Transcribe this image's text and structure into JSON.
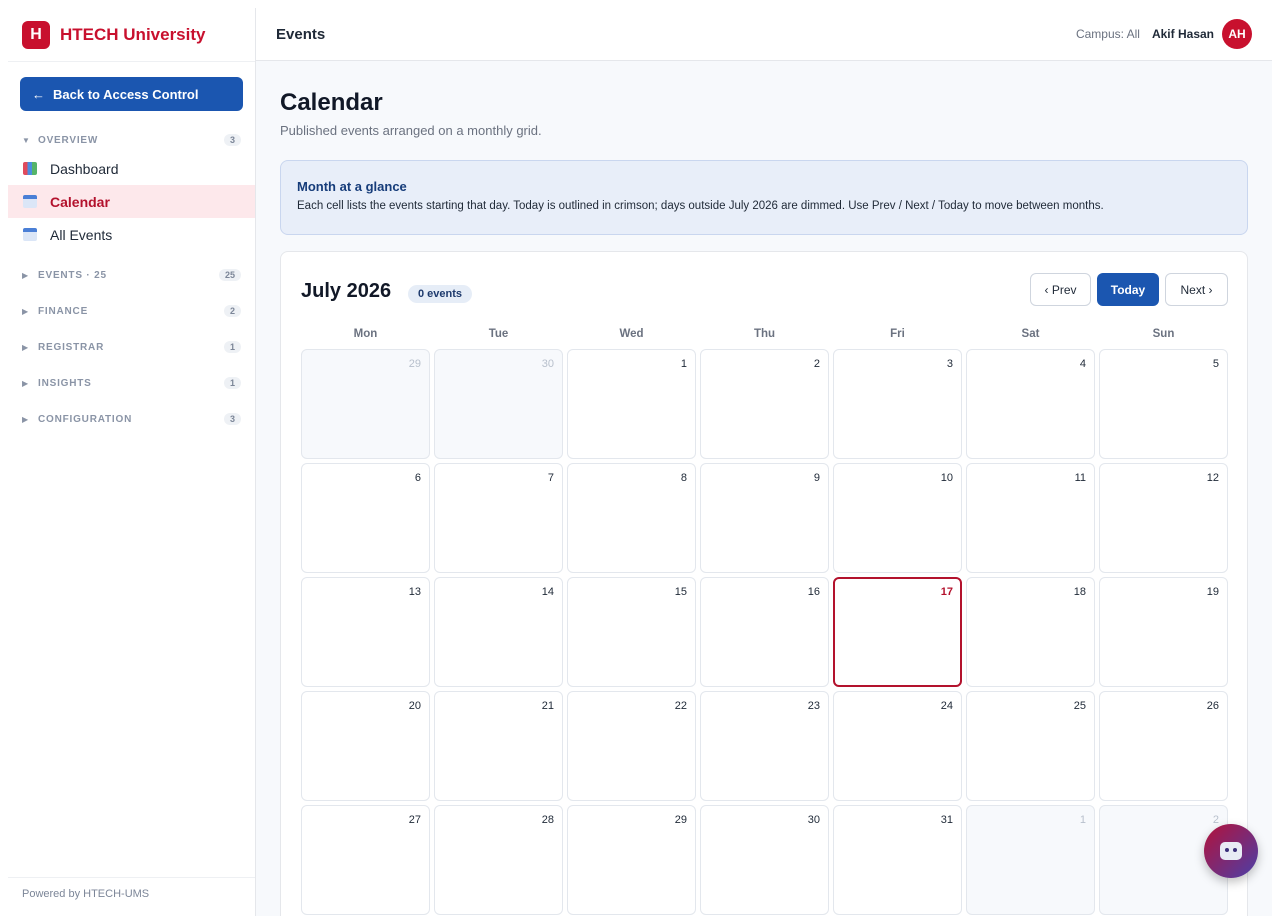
{
  "brand": {
    "logo": "H",
    "name": "HTECH University"
  },
  "sidebar": {
    "back_label": "Back to Access Control",
    "back_arrow": "←",
    "sections": [
      {
        "label": "OVERVIEW",
        "count": "3",
        "expanded": true,
        "items": [
          {
            "label": "Dashboard",
            "icon": "chart-icon",
            "active": false
          },
          {
            "label": "Calendar",
            "icon": "calendar-icon",
            "active": true
          },
          {
            "label": "All Events",
            "icon": "calendar-icon",
            "active": false
          }
        ]
      },
      {
        "label": "EVENTS · 25",
        "count": "25",
        "expanded": false
      },
      {
        "label": "FINANCE",
        "count": "2",
        "expanded": false
      },
      {
        "label": "REGISTRAR",
        "count": "1",
        "expanded": false
      },
      {
        "label": "INSIGHTS",
        "count": "1",
        "expanded": false
      },
      {
        "label": "CONFIGURATION",
        "count": "3",
        "expanded": false
      }
    ],
    "footer": "Powered by HTECH-UMS"
  },
  "topbar": {
    "title": "Events",
    "campus": "Campus: All",
    "user": "Akif Hasan",
    "avatar": "AH"
  },
  "page": {
    "title": "Calendar",
    "subtitle": "Published events arranged on a monthly grid.",
    "info_title": "Month at a glance",
    "info_text": "Each cell lists the events starting that day. Today is outlined in crimson; days outside July 2026 are dimmed. Use Prev / Next / Today to move between months."
  },
  "calendar": {
    "month": "July 2026",
    "events_badge": "0 events",
    "prev_label": "‹ Prev",
    "today_label": "Today",
    "next_label": "Next ›",
    "weekdays": [
      "Mon",
      "Tue",
      "Wed",
      "Thu",
      "Fri",
      "Sat",
      "Sun"
    ],
    "weeks": [
      [
        {
          "d": "29",
          "out": true
        },
        {
          "d": "30",
          "out": true
        },
        {
          "d": "1"
        },
        {
          "d": "2"
        },
        {
          "d": "3"
        },
        {
          "d": "4"
        },
        {
          "d": "5"
        }
      ],
      [
        {
          "d": "6"
        },
        {
          "d": "7"
        },
        {
          "d": "8"
        },
        {
          "d": "9"
        },
        {
          "d": "10"
        },
        {
          "d": "11"
        },
        {
          "d": "12"
        }
      ],
      [
        {
          "d": "13"
        },
        {
          "d": "14"
        },
        {
          "d": "15"
        },
        {
          "d": "16"
        },
        {
          "d": "17",
          "today": true
        },
        {
          "d": "18"
        },
        {
          "d": "19"
        }
      ],
      [
        {
          "d": "20"
        },
        {
          "d": "21"
        },
        {
          "d": "22"
        },
        {
          "d": "23"
        },
        {
          "d": "24"
        },
        {
          "d": "25"
        },
        {
          "d": "26"
        }
      ],
      [
        {
          "d": "27"
        },
        {
          "d": "28"
        },
        {
          "d": "29"
        },
        {
          "d": "30"
        },
        {
          "d": "31"
        },
        {
          "d": "1",
          "out": true
        },
        {
          "d": "2",
          "out": true
        }
      ]
    ]
  },
  "assistant": {
    "icon": "robot-icon"
  },
  "colors": {
    "brand": "#c8102e",
    "primary": "#1b56b0",
    "today_outline": "#b3122d"
  }
}
